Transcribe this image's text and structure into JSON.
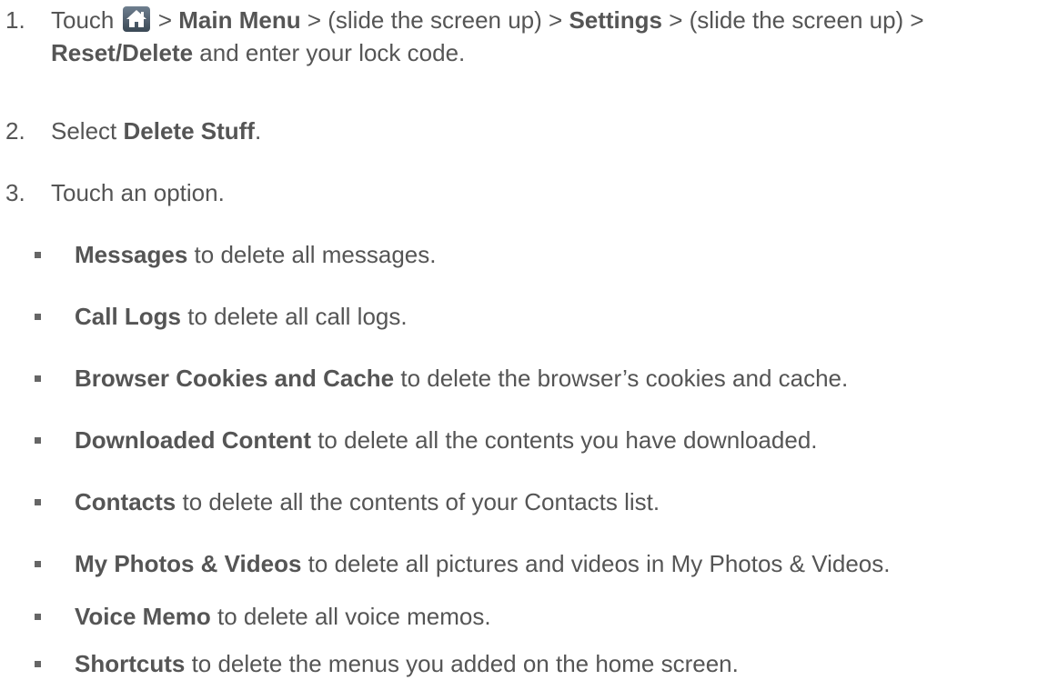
{
  "steps": [
    {
      "number": "1.",
      "touch": "Touch",
      "sep1": " > ",
      "main_menu": "Main Menu",
      "slide1": " > (slide the screen up) > ",
      "settings": "Settings",
      "slide2": " > (slide the screen up) > ",
      "reset_delete": "Reset/Delete",
      "tail": " and enter your lock code."
    },
    {
      "number": "2.",
      "prefix": "Select ",
      "bold": "Delete Stuff",
      "suffix": "."
    },
    {
      "number": "3.",
      "text": "Touch an option."
    }
  ],
  "options": [
    {
      "bold": "Messages",
      "text": " to delete all messages."
    },
    {
      "bold": "Call Logs",
      "text": " to delete all call logs."
    },
    {
      "bold": "Browser Cookies and Cache",
      "text": " to delete the browser’s cookies and cache."
    },
    {
      "bold": "Downloaded Content",
      "text": " to delete all the contents you have downloaded."
    },
    {
      "bold": "Contacts",
      "text": " to delete all the contents of your Contacts list."
    },
    {
      "bold": "My Photos & Videos",
      "text": " to delete all pictures and videos in My Photos & Videos."
    },
    {
      "bold": "Voice Memo",
      "text": " to delete all voice memos."
    },
    {
      "bold": "Shortcuts",
      "text": " to delete the menus you added on the home screen."
    }
  ],
  "icons": {
    "home": "home-icon"
  },
  "colors": {
    "text": "#555555",
    "home_icon_bg": "#4a5a6a"
  }
}
